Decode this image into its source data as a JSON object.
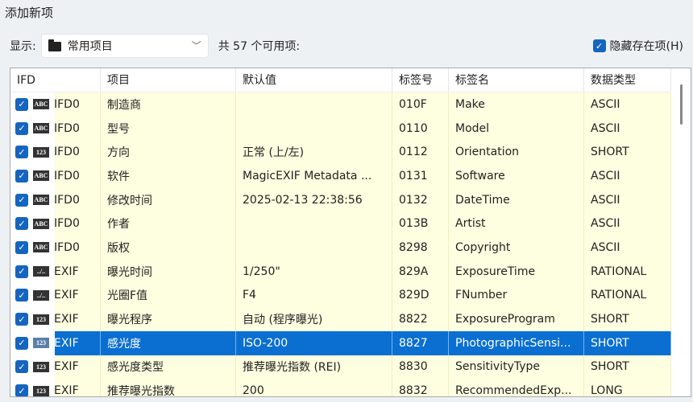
{
  "title": "添加新项",
  "toolbar": {
    "show_label": "显示:",
    "category": "常用项目",
    "count_text": "共 57 个可用项:",
    "hide_existing": "隐藏存在项(H)"
  },
  "columns": [
    "IFD",
    "项目",
    "默认值",
    "标签号",
    "标签名",
    "数据类型"
  ],
  "rows": [
    {
      "type": "ABC",
      "ifd": "IFD0",
      "item": "制造商",
      "default": "",
      "tag": "010F",
      "name": "Make",
      "dtype": "ASCII"
    },
    {
      "type": "ABC",
      "ifd": "IFD0",
      "item": "型号",
      "default": "",
      "tag": "0110",
      "name": "Model",
      "dtype": "ASCII"
    },
    {
      "type": "123",
      "ifd": "IFD0",
      "item": "方向",
      "default": "正常 (上/左)",
      "tag": "0112",
      "name": "Orientation",
      "dtype": "SHORT"
    },
    {
      "type": "ABC",
      "ifd": "IFD0",
      "item": "软件",
      "default": "MagicEXIF Metadata ...",
      "tag": "0131",
      "name": "Software",
      "dtype": "ASCII"
    },
    {
      "type": "ABC",
      "ifd": "IFD0",
      "item": "修改时间",
      "default": "2025-02-13 22:38:56",
      "tag": "0132",
      "name": "DateTime",
      "dtype": "ASCII"
    },
    {
      "type": "ABC",
      "ifd": "IFD0",
      "item": "作者",
      "default": "",
      "tag": "013B",
      "name": "Artist",
      "dtype": "ASCII"
    },
    {
      "type": "ABC",
      "ifd": "IFD0",
      "item": "版权",
      "default": "",
      "tag": "8298",
      "name": "Copyright",
      "dtype": "ASCII"
    },
    {
      "type": "../..",
      "ifd": "EXIF",
      "item": "曝光时间",
      "default": "1/250\"",
      "tag": "829A",
      "name": "ExposureTime",
      "dtype": "RATIONAL"
    },
    {
      "type": "../..",
      "ifd": "EXIF",
      "item": "光圈F值",
      "default": "F4",
      "tag": "829D",
      "name": "FNumber",
      "dtype": "RATIONAL"
    },
    {
      "type": "123",
      "ifd": "EXIF",
      "item": "曝光程序",
      "default": "自动 (程序曝光)",
      "tag": "8822",
      "name": "ExposureProgram",
      "dtype": "SHORT"
    },
    {
      "type": "123",
      "ifd": "EXIF",
      "item": "感光度",
      "default": "ISO-200",
      "tag": "8827",
      "name": "PhotographicSensi...",
      "dtype": "SHORT",
      "selected": true
    },
    {
      "type": "123",
      "ifd": "EXIF",
      "item": "感光度类型",
      "default": "推荐曝光指数 (REI)",
      "tag": "8830",
      "name": "SensitivityType",
      "dtype": "SHORT"
    },
    {
      "type": "123",
      "ifd": "EXIF",
      "item": "推荐曝光指数",
      "default": "200",
      "tag": "8832",
      "name": "RecommendedExp...",
      "dtype": "LONG"
    }
  ]
}
